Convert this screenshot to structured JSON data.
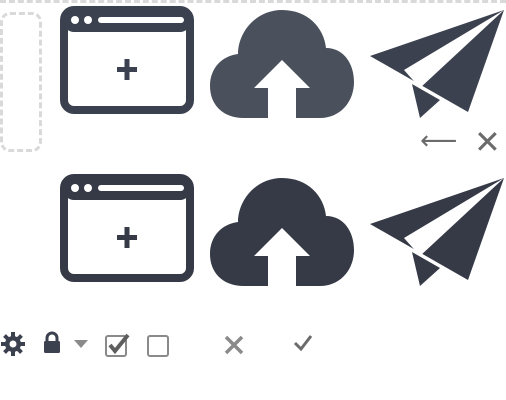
{
  "colors": {
    "icon_dark": "#3b414e",
    "icon_darker": "#353a46",
    "icon_grey": "#6b6b6b",
    "icon_light_grey": "#8a8a8a",
    "dashed": "#d9d9d9"
  },
  "rows": [
    {
      "name": "row-primary",
      "icons": [
        "new-window-icon",
        "cloud-upload-icon",
        "paper-plane-icon"
      ]
    },
    {
      "name": "row-secondary",
      "icons": [
        "new-window-icon",
        "cloud-upload-icon",
        "paper-plane-icon"
      ]
    }
  ],
  "controls": {
    "back_arrow": "⟵",
    "close": "✕"
  },
  "small_icons": [
    "gear-icon",
    "lock-icon",
    "caret-down-icon",
    "checkbox-checked-icon",
    "checkbox-empty-icon",
    "close-icon",
    "checkmark-icon"
  ]
}
